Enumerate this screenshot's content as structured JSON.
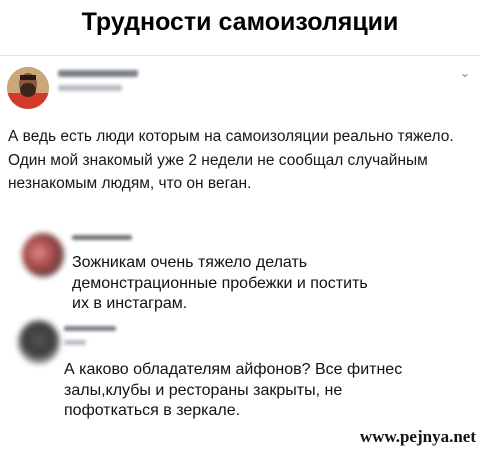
{
  "title": "Трудности самоизоляции",
  "post": {
    "text": "А ведь есть люди которым на самоизоляции реально тяжело. Один мой знакомый уже 2 недели не сообщал случайным незнакомым людям, что он веган."
  },
  "comments": [
    {
      "text": "Зожникам очень тяжело делать демонстрационные пробежки и постить их в инстаграм."
    },
    {
      "text": "А каково обладателям айфонов? Все фитнес залы,клубы и рестораны закрыты, не пофоткаться в зеркале."
    }
  ],
  "watermark": "www.pejnya.net",
  "icons": {
    "menu": "chevron-down-icon"
  }
}
